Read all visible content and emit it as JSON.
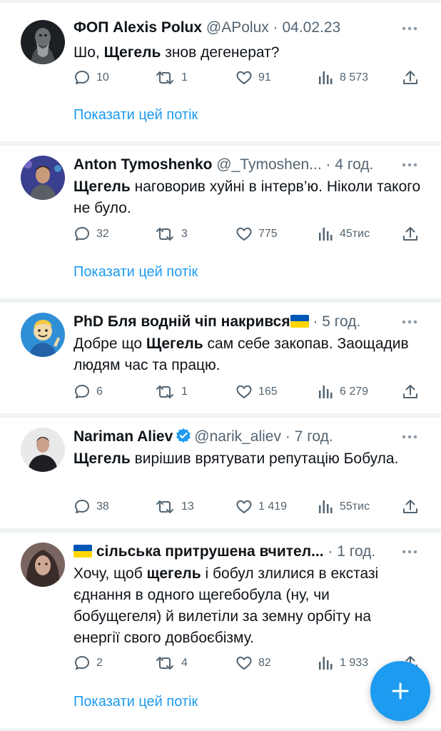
{
  "tweets": [
    {
      "name": "ФОП Alexis Polux",
      "handle": "@APolux",
      "dot": "·",
      "time": "04.02.23",
      "text_before": "Шо, ",
      "bold": "Щегель",
      "text_after": " знов дегенерат?",
      "replies": "10",
      "retweets": "1",
      "likes": "91",
      "views": "8 573",
      "show_thread": "Показати цей потік"
    },
    {
      "name": "Anton Tymoshenko",
      "handle": "@_Tymoshen...",
      "dot": "·",
      "time": "4 год.",
      "text_before": "",
      "bold": "Щегель",
      "text_after": " наговорив хуйні в інтерв’ю. Ніколи такого не було.",
      "replies": "32",
      "retweets": "3",
      "likes": "775",
      "views": "45тис",
      "show_thread": "Показати цей потік"
    },
    {
      "name": "PhD Бля водній чіп накрився",
      "handle": "",
      "dot": "·",
      "time": "5 год.",
      "text_before": "Добре що ",
      "bold": "Щегель",
      "text_after": " сам себе закопав. Заощадив людям час та працю.",
      "replies": "6",
      "retweets": "1",
      "likes": "165",
      "views": "6 279",
      "show_thread": ""
    },
    {
      "name": "Nariman Aliev",
      "handle": "@narik_aliev",
      "dot": "·",
      "time": "7 год.",
      "text_before": "",
      "bold": "Щегель",
      "text_after": " вирішив врятувати репутацію Бобула.",
      "replies": "38",
      "retweets": "13",
      "likes": "1 419",
      "views": "55тис",
      "show_thread": ""
    },
    {
      "name": "сільська притрушена вчител...",
      "handle": "",
      "dot": "·",
      "time": "1 год.",
      "text_before": "Хочу, щоб ",
      "bold": "щегель",
      "text_after": " і бобул злилися в екстазі єднання в одного щегебобула (ну, чи бобущегеля) й вилетіли за земну орбіту на енергії свого довбоєбізму.",
      "replies": "2",
      "retweets": "4",
      "likes": "82",
      "views": "1 933",
      "show_thread": "Показати цей потік"
    }
  ],
  "colors": {
    "accent": "#1d9bf0",
    "secondary_text": "#536471",
    "separator": "#eff3f4",
    "flag_blue": "#0057b7",
    "flag_yellow": "#ffd700"
  },
  "icons": {
    "reply": "speech-bubble-icon",
    "retweet": "retweet-arrows-icon",
    "like": "heart-icon",
    "views": "bar-chart-icon",
    "share": "share-upload-icon",
    "more": "more-dots-icon",
    "compose": "plus-icon",
    "verified": "verified-badge-icon",
    "flag": "ukraine-flag-icon"
  }
}
